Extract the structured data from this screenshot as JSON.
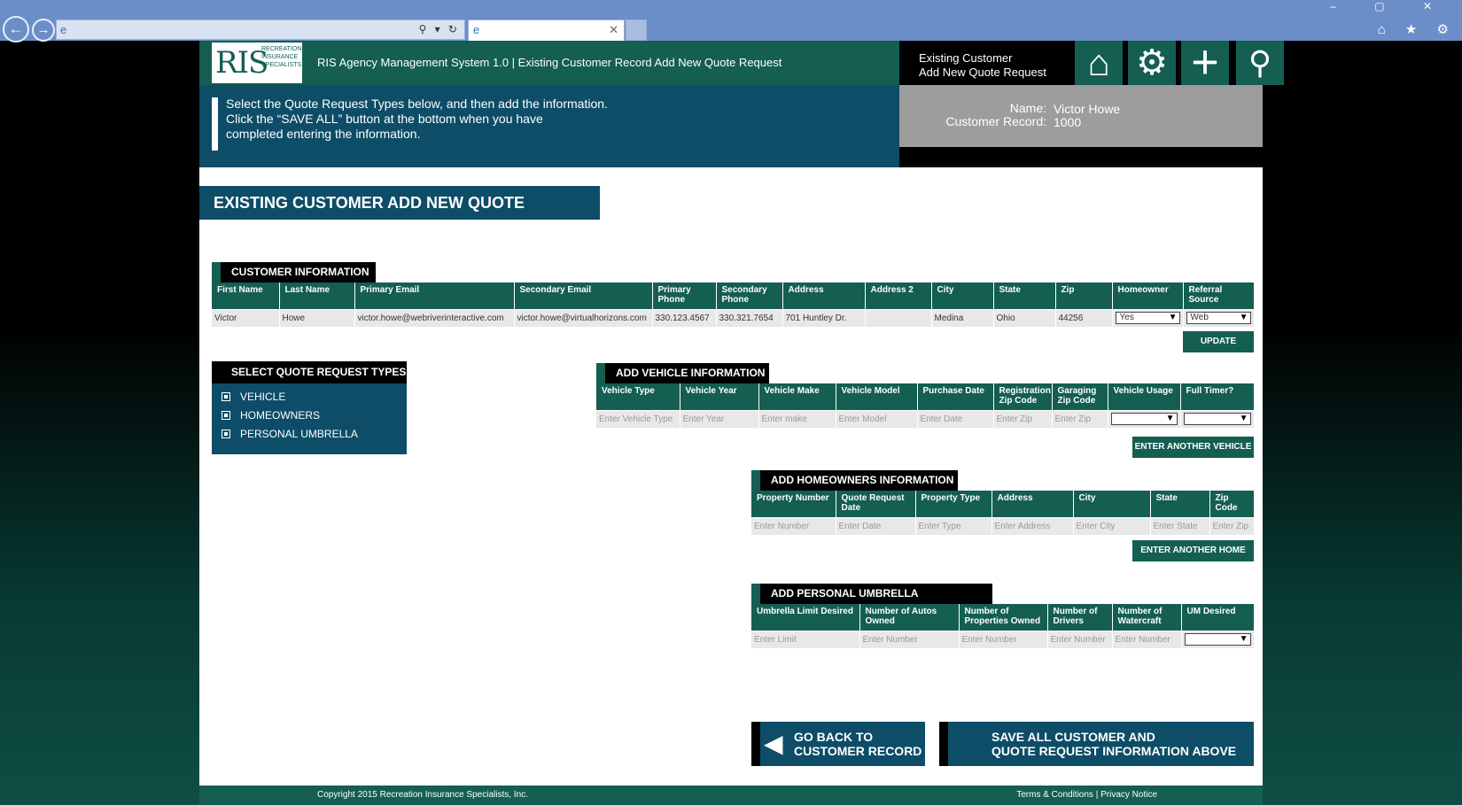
{
  "browser": {
    "back_icon": "←",
    "forward_icon": "→",
    "address_text": "",
    "tab_title": "",
    "addr_icons": "⚲ ▾ ↻",
    "win_controls": "– ▢ ✕",
    "right_icons": "⌂ ★ ⚙"
  },
  "header": {
    "logo_letters": "RIS",
    "logo_sub": "RECREATION INSURANCE SPECIALISTS",
    "title": "RIS Agency Management System 1.0 | Existing Customer Record Add New Quote Request",
    "right_label_line1": "Existing Customer",
    "right_label_line2": "Add New Quote Request",
    "icons": [
      "home-icon",
      "gear-icon",
      "plus-icon",
      "search-icon"
    ]
  },
  "banner": {
    "line1": "Select the Quote Request Types below, and then add the information.",
    "line2": "Click the “SAVE ALL” button at the bottom when you have",
    "line3": "completed entering the information."
  },
  "customer_box": {
    "name_label": "Name:",
    "name_value": "Victor Howe",
    "record_label": "Customer Record:",
    "record_value": "1000"
  },
  "page_title": "EXISTING CUSTOMER ADD NEW QUOTE REQUEST",
  "customer_info": {
    "title": "CUSTOMER INFORMATION",
    "headers": [
      "First Name",
      "Last Name",
      "Primary Email",
      "Secondary Email",
      "Primary Phone",
      "Secondary Phone",
      "Address",
      "Address 2",
      "City",
      "State",
      "Zip",
      "Homeowner",
      "Referral Source"
    ],
    "row": {
      "first": "Victor",
      "last": "Howe",
      "primary_email": "victor.howe@webriverinteractive.com",
      "secondary_email": "victor.howe@virtualhorizons.com",
      "primary_phone": "330.123.4567",
      "secondary_phone": "330.321.7654",
      "address": "701 Huntley Dr.",
      "address2": "",
      "city": "Medina",
      "state": "Ohio",
      "zip": "44256",
      "homeowner": "Yes",
      "referral": "Web"
    },
    "update_label": "UPDATE"
  },
  "quote_types": {
    "title": "SELECT QUOTE REQUEST TYPES",
    "items": [
      "VEHICLE",
      "HOMEOWNERS",
      "PERSONAL UMBRELLA"
    ]
  },
  "vehicle": {
    "title": "ADD VEHICLE INFORMATION",
    "headers": [
      "Vehicle  Type",
      "Vehicle Year",
      "Vehicle Make",
      "Vehicle Model",
      "Purchase Date",
      "Registration Zip Code",
      "Garaging Zip Code",
      "Vehicle Usage",
      "Full Timer?"
    ],
    "placeholders": [
      "Enter Vehicle Type",
      "Enter Year",
      "Enter make",
      "Enter Model",
      "Enter Date",
      "Enter Zip",
      "Enter Zip"
    ],
    "button": "ENTER ANOTHER VEHICLE"
  },
  "homeowners": {
    "title": "ADD HOMEOWNERS INFORMATION",
    "headers": [
      "Property Number",
      "Quote Request Date",
      "Property Type",
      "Address",
      "City",
      "State",
      "Zip Code"
    ],
    "placeholders": [
      "Enter Number",
      "Enter Date",
      "Enter Type",
      "Enter Address",
      "Enter City",
      "Enter State",
      "Enter Zip"
    ],
    "button": "ENTER ANOTHER HOME"
  },
  "umbrella": {
    "title": "ADD PERSONAL UMBRELLA INFORMATION",
    "headers": [
      "Umbrella Limit Desired",
      "Number of Autos Owned",
      "Number of Properties Owned",
      "Number of Drivers",
      "Number of Watercraft",
      "UM Desired"
    ],
    "placeholders": [
      "Enter Limit",
      "Enter Number",
      "Enter Number",
      "Enter Number",
      "Enter Number"
    ]
  },
  "actions": {
    "back_line1": "GO BACK TO",
    "back_line2": "CUSTOMER RECORD",
    "save_line1": "SAVE ALL CUSTOMER AND",
    "save_line2": "QUOTE REQUEST INFORMATION ABOVE"
  },
  "footer": {
    "copyright": "Copyright 2015 Recreation Insurance Specialists, Inc.",
    "terms": "Terms & Conditions",
    "sep": " | ",
    "privacy": "Privacy Notice"
  },
  "colors": {
    "green": "#145e52",
    "blue": "#0d4d68",
    "gray": "#9d9d9d"
  }
}
